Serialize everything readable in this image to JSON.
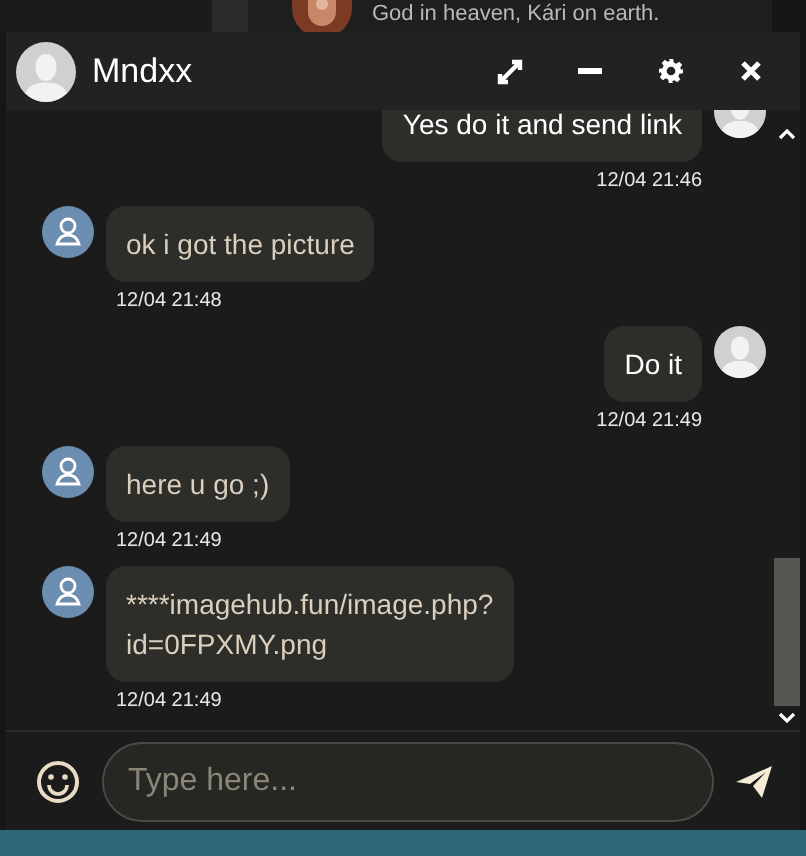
{
  "background_post": {
    "text": "God in heaven, Kári on earth."
  },
  "chat": {
    "contact_name": "Mndxx",
    "messages": [
      {
        "kind": "sent",
        "text": "Yes do it and send link",
        "time": "12/04 21:46"
      },
      {
        "kind": "received",
        "text": "ok i got the picture",
        "time": "12/04 21:48"
      },
      {
        "kind": "sent",
        "text": "Do it",
        "time": "12/04 21:49"
      },
      {
        "kind": "received",
        "text": "here u go ;)",
        "time": "12/04 21:49"
      },
      {
        "kind": "received",
        "text": "****imagehub.fun/image.php?\nid=0FPXMY.png",
        "time": "12/04 21:49"
      }
    ],
    "input": {
      "placeholder": "Type here..."
    }
  }
}
